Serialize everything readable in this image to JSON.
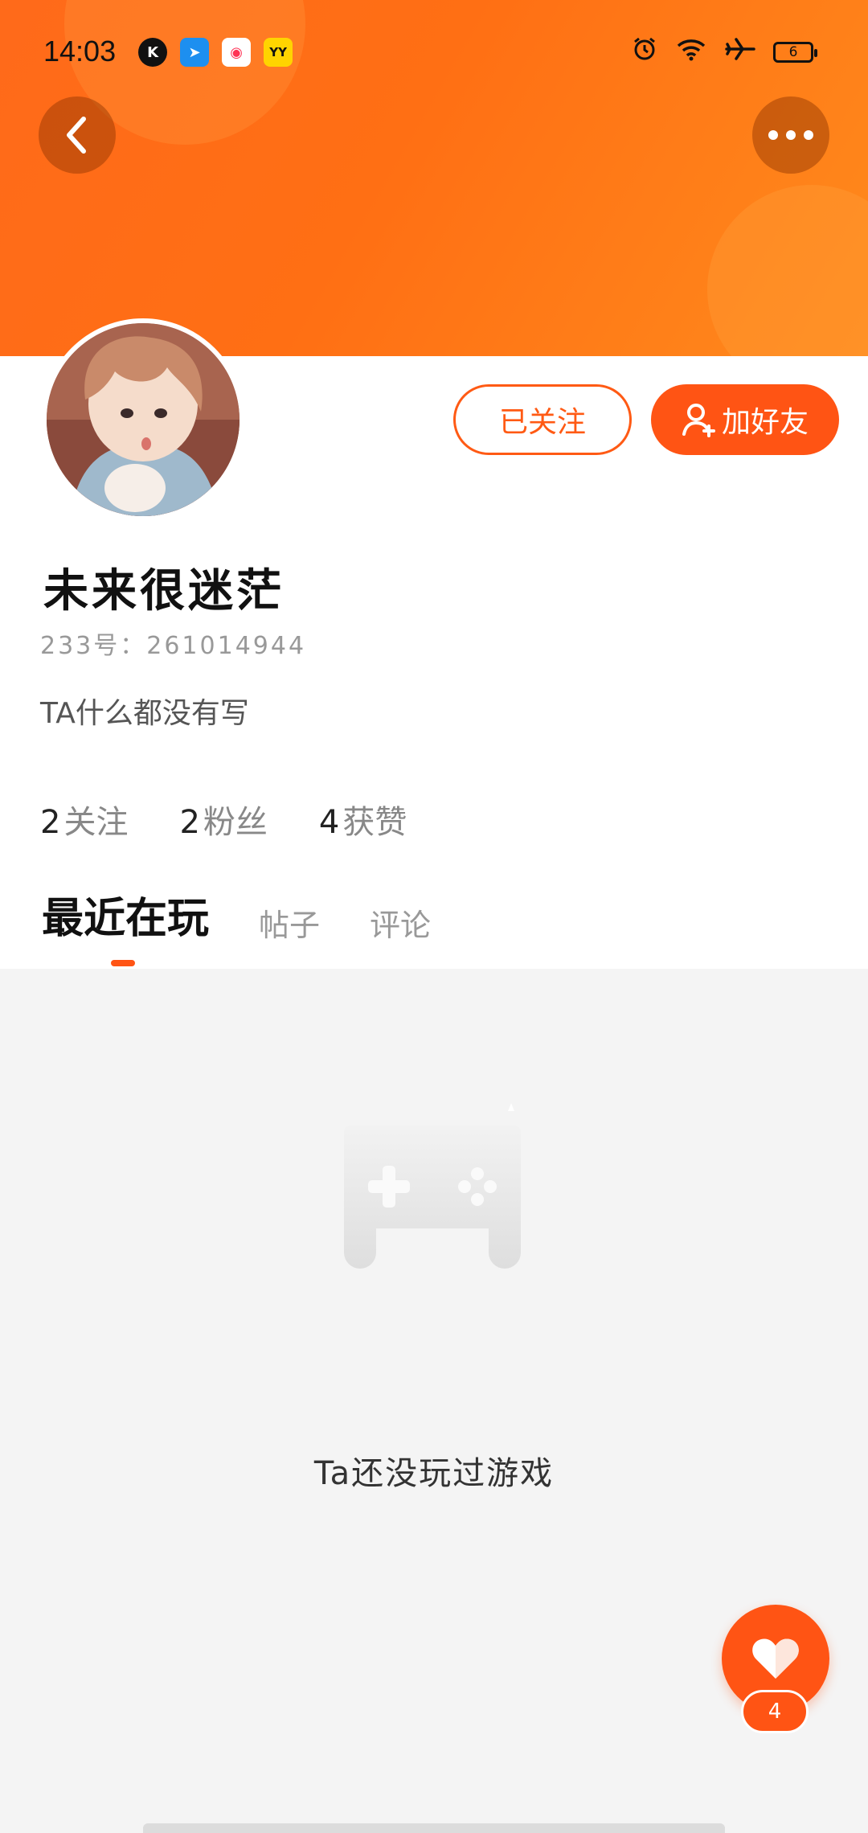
{
  "status_bar": {
    "time": "14:03",
    "notif_icons": [
      "K",
      "➤",
      "◉",
      "YY"
    ],
    "battery": "6"
  },
  "header": {
    "back_icon": "chevron-left-icon",
    "more_icon": "more-horizontal-icon"
  },
  "actions": {
    "follow_label": "已关注",
    "add_friend_label": "加好友"
  },
  "profile": {
    "name": "未来很迷茫",
    "id_text": "233号：261014944",
    "bio": "TA什么都没有写"
  },
  "stats": [
    {
      "num": "2",
      "label": "关注"
    },
    {
      "num": "2",
      "label": "粉丝"
    },
    {
      "num": "4",
      "label": "获赞"
    }
  ],
  "tabs": [
    "最近在玩",
    "帖子",
    "评论"
  ],
  "empty_state": {
    "text": "Ta还没玩过游戏",
    "icon": "gamepad-icon"
  },
  "like": {
    "count": "4"
  },
  "colors": {
    "accent": "#ff5414",
    "banner": "#ff6f14"
  }
}
